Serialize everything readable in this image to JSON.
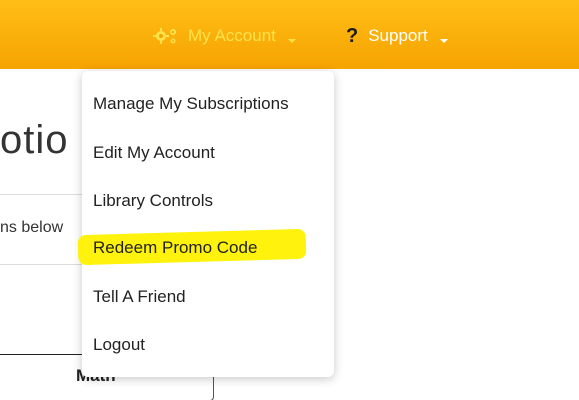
{
  "navbar": {
    "account_label": "My Account",
    "support_label": "Support",
    "account_icon": "gears-icon",
    "support_icon": "question-icon",
    "colors": {
      "bar": "#f6a300",
      "account_text": "#ffe24a",
      "support_text": "#ffffff"
    }
  },
  "background": {
    "title_fragment": "otio",
    "subtext_fragment": "ns below",
    "math_label": "Math"
  },
  "dropdown": {
    "items": [
      {
        "label": "Manage My Subscriptions"
      },
      {
        "label": "Edit My Account"
      },
      {
        "label": "Library Controls"
      },
      {
        "label": "Redeem Promo Code",
        "highlighted": true
      },
      {
        "label": "Tell A Friend"
      },
      {
        "label": "Logout"
      }
    ],
    "highlight_color": "#fff200"
  }
}
